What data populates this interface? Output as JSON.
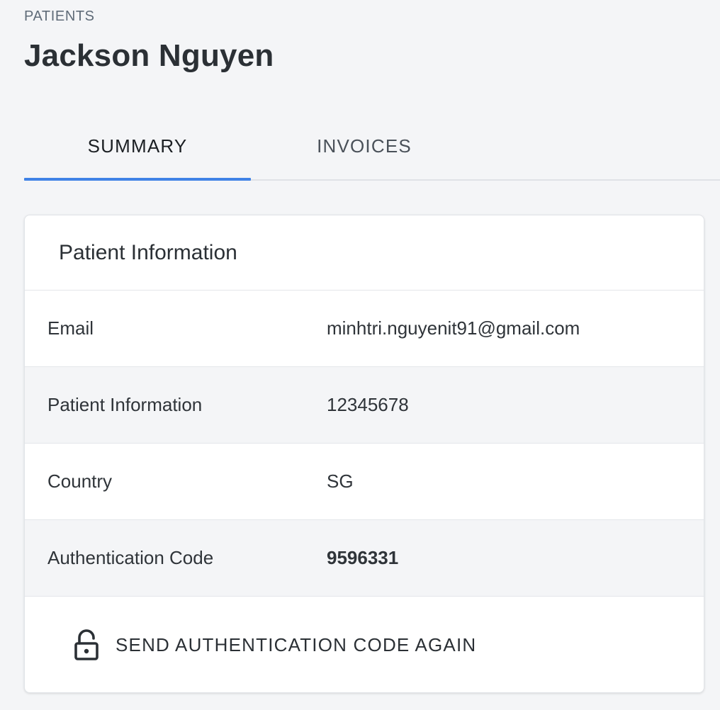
{
  "breadcrumb": "PATIENTS",
  "page_title": "Jackson Nguyen",
  "tabs": [
    {
      "label": "SUMMARY",
      "active": true
    },
    {
      "label": "INVOICES",
      "active": false
    }
  ],
  "accent_color": "#3f82e6",
  "card": {
    "title": "Patient Information",
    "rows": [
      {
        "label": "Email",
        "value": "minhtri.nguyenit91@gmail.com"
      },
      {
        "label": "Patient Information",
        "value": "12345678"
      },
      {
        "label": "Country",
        "value": "SG"
      },
      {
        "label": "Authentication Code",
        "value": "9596331"
      }
    ],
    "action": {
      "icon": "lock-open-icon",
      "label": "SEND AUTHENTICATION CODE AGAIN"
    }
  }
}
